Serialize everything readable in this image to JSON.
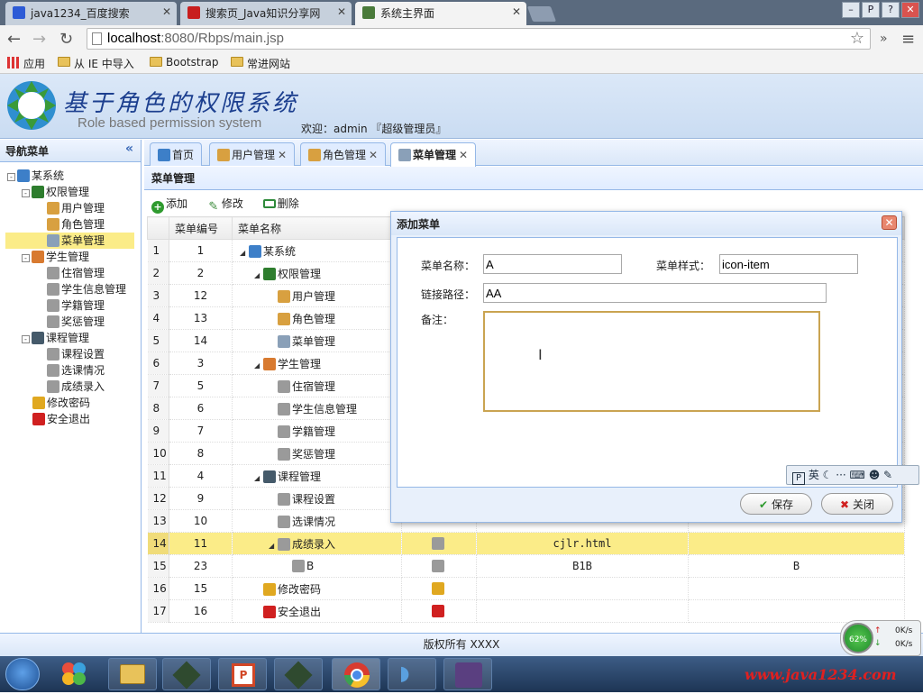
{
  "browser": {
    "tabs": [
      {
        "title": "java1234_百度搜索",
        "color": "#2d5bd6"
      },
      {
        "title": "搜索页_Java知识分享网",
        "color": "#c81e1e"
      },
      {
        "title": "系统主界面",
        "color": "#4a7a3a"
      }
    ],
    "url_host": "localhost",
    "url_rest": ":8080/Rbps/main.jsp",
    "bookmarks": [
      "应用",
      "从 IE 中导入",
      "Bootstrap",
      "常进网站"
    ]
  },
  "header": {
    "title": "基于角色的权限系统",
    "subtitle": "Role based permission system",
    "welcome": "欢迎：admin 『超级管理员』"
  },
  "sidebar": {
    "title": "导航菜单",
    "collapse_icon": "«",
    "items": [
      {
        "label": "某系统",
        "level": 0,
        "icon": "home-icon",
        "toggle": "-",
        "color": "#3d7fc8"
      },
      {
        "label": "权限管理",
        "level": 1,
        "icon": "permission-icon",
        "toggle": "-",
        "color": "#2e7d2e"
      },
      {
        "label": "用户管理",
        "level": 2,
        "icon": "user-icon",
        "color": "#d8a040"
      },
      {
        "label": "角色管理",
        "level": 2,
        "icon": "role-icon",
        "color": "#d8a040"
      },
      {
        "label": "菜单管理",
        "level": 2,
        "icon": "menu-icon",
        "color": "#8aa0b8",
        "selected": true
      },
      {
        "label": "学生管理",
        "level": 1,
        "icon": "students-icon",
        "toggle": "-",
        "color": "#d87a30"
      },
      {
        "label": "住宿管理",
        "level": 2,
        "icon": "gear-icon",
        "color": "#9a9a9a"
      },
      {
        "label": "学生信息管理",
        "level": 2,
        "icon": "gear-icon",
        "color": "#9a9a9a"
      },
      {
        "label": "学籍管理",
        "level": 2,
        "icon": "gear-icon",
        "color": "#9a9a9a"
      },
      {
        "label": "奖惩管理",
        "level": 2,
        "icon": "gear-icon",
        "color": "#9a9a9a"
      },
      {
        "label": "课程管理",
        "level": 1,
        "icon": "monitor-icon",
        "toggle": "-",
        "color": "#455a6a"
      },
      {
        "label": "课程设置",
        "level": 2,
        "icon": "gear-icon",
        "color": "#9a9a9a"
      },
      {
        "label": "选课情况",
        "level": 2,
        "icon": "gear-icon",
        "color": "#9a9a9a"
      },
      {
        "label": "成绩录入",
        "level": 2,
        "icon": "gear-icon",
        "color": "#9a9a9a"
      },
      {
        "label": "修改密码",
        "level": 1,
        "icon": "lock-icon",
        "color": "#e0a820"
      },
      {
        "label": "安全退出",
        "level": 1,
        "icon": "exit-icon",
        "color": "#d02020"
      }
    ]
  },
  "tabs": [
    {
      "label": "首页",
      "icon": "home-icon",
      "closable": false
    },
    {
      "label": "用户管理",
      "icon": "user-icon",
      "closable": true
    },
    {
      "label": "角色管理",
      "icon": "role-icon",
      "closable": true
    },
    {
      "label": "菜单管理",
      "icon": "menu-icon",
      "closable": true,
      "active": true
    }
  ],
  "panel": {
    "title": "菜单管理"
  },
  "toolbar": {
    "add": "添加",
    "edit": "修改",
    "delete": "删除"
  },
  "grid": {
    "headers": [
      "",
      "菜单编号",
      "菜单名称",
      "",
      "",
      ""
    ],
    "rows": [
      {
        "n": "1",
        "id": "1",
        "name": "某系统",
        "indent": 0,
        "expander": true,
        "icon": "home-icon"
      },
      {
        "n": "2",
        "id": "2",
        "name": "权限管理",
        "indent": 1,
        "expander": true,
        "icon": "permission-icon"
      },
      {
        "n": "3",
        "id": "12",
        "name": "用户管理",
        "indent": 2,
        "icon": "user-icon"
      },
      {
        "n": "4",
        "id": "13",
        "name": "角色管理",
        "indent": 2,
        "icon": "role-icon"
      },
      {
        "n": "5",
        "id": "14",
        "name": "菜单管理",
        "indent": 2,
        "icon": "menu-icon"
      },
      {
        "n": "6",
        "id": "3",
        "name": "学生管理",
        "indent": 1,
        "expander": true,
        "icon": "students-icon"
      },
      {
        "n": "7",
        "id": "5",
        "name": "住宿管理",
        "indent": 2,
        "icon": "gear-icon"
      },
      {
        "n": "8",
        "id": "6",
        "name": "学生信息管理",
        "indent": 2,
        "icon": "gear-icon"
      },
      {
        "n": "9",
        "id": "7",
        "name": "学籍管理",
        "indent": 2,
        "icon": "gear-icon"
      },
      {
        "n": "10",
        "id": "8",
        "name": "奖惩管理",
        "indent": 2,
        "icon": "gear-icon"
      },
      {
        "n": "11",
        "id": "4",
        "name": "课程管理",
        "indent": 1,
        "expander": true,
        "icon": "monitor-icon"
      },
      {
        "n": "12",
        "id": "9",
        "name": "课程设置",
        "indent": 2,
        "icon": "gear-icon"
      },
      {
        "n": "13",
        "id": "10",
        "name": "选课情况",
        "indent": 2,
        "icon": "gear-icon"
      },
      {
        "n": "14",
        "id": "11",
        "name": "成绩录入",
        "indent": 2,
        "expander": true,
        "icon": "gear-icon",
        "style_icon": "gear-icon",
        "url": "cjlr.html",
        "note": "",
        "highlight": true
      },
      {
        "n": "15",
        "id": "23",
        "name": "B",
        "indent": 3,
        "icon": "gear-icon",
        "style_icon": "gear-icon",
        "url": "B1B",
        "note": "B"
      },
      {
        "n": "16",
        "id": "15",
        "name": "修改密码",
        "indent": 1,
        "icon": "lock-icon",
        "style_icon": "lock-icon",
        "url": "",
        "note": ""
      },
      {
        "n": "17",
        "id": "16",
        "name": "安全退出",
        "indent": 1,
        "icon": "exit-icon",
        "style_icon": "exit-icon",
        "url": "",
        "note": ""
      }
    ]
  },
  "dialog": {
    "title": "添加菜单",
    "name_label": "菜单名称：",
    "name_value": "A",
    "style_label": "菜单样式：",
    "style_value": "icon-item",
    "url_label": "链接路径：",
    "url_value": "AA",
    "remark_label": "备注：",
    "remark_value": "",
    "save": "保存",
    "close": "关闭"
  },
  "ime": {
    "label": "英"
  },
  "footer": {
    "text": "版权所有 XXXX"
  },
  "netmon": {
    "percent": "62%",
    "up": "0K/s",
    "down": "0K/s"
  },
  "watermark": "www.java1234.com",
  "colors": {
    "accent": "#95b8e7",
    "highlight": "#fbec88",
    "banner_title": "#1c3f8f"
  }
}
